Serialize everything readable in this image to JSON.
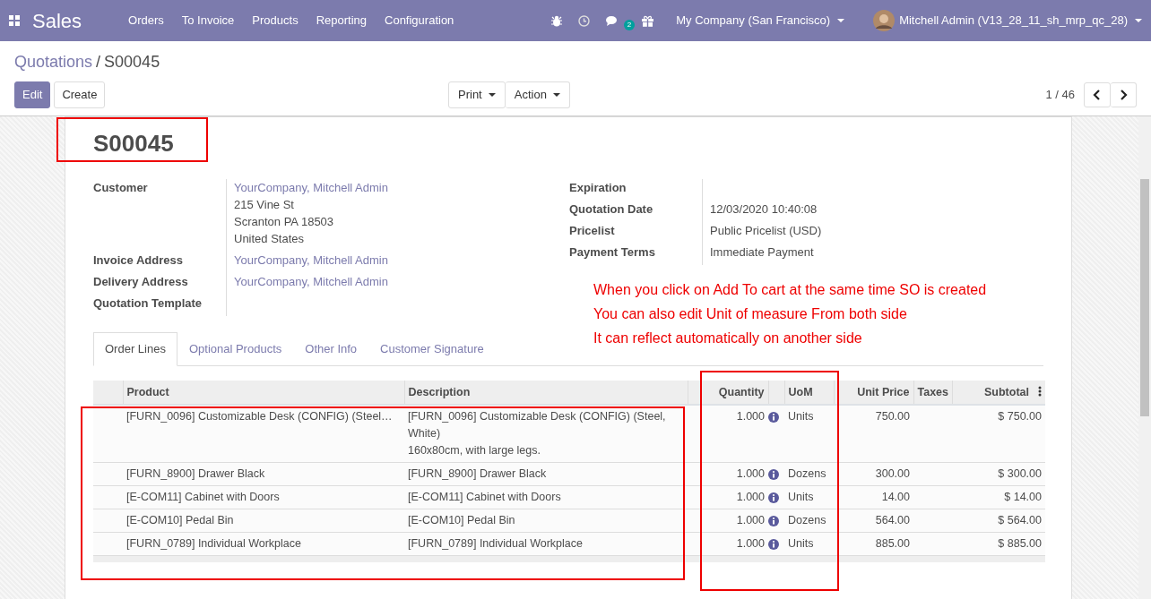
{
  "navbar": {
    "app_name": "Sales",
    "menu": [
      "Orders",
      "To Invoice",
      "Products",
      "Reporting",
      "Configuration"
    ],
    "messages_count": "2",
    "company": "My Company (San Francisco)",
    "user": "Mitchell Admin (V13_28_11_sh_mrp_qc_28)"
  },
  "breadcrumb_separator": "/",
  "breadcrumb": [
    {
      "label": "Quotations",
      "selected": false
    },
    {
      "label": "S00045",
      "selected": true
    }
  ],
  "buttons": {
    "edit": "Edit",
    "create": "Create",
    "print": "Print",
    "action": "Action"
  },
  "pager": "1 / 46",
  "record": {
    "title": "S00045",
    "left_fields": [
      {
        "label": "Customer",
        "lines": [
          {
            "text": "YourCompany, Mitchell Admin",
            "kind": "link"
          },
          {
            "text": "215 Vine St",
            "kind": "text"
          },
          {
            "text": "Scranton PA 18503",
            "kind": "text"
          },
          {
            "text": "United States",
            "kind": "text"
          }
        ]
      },
      {
        "label": "Invoice Address",
        "lines": [
          {
            "text": "YourCompany, Mitchell Admin",
            "kind": "link"
          }
        ]
      },
      {
        "label": "Delivery Address",
        "lines": [
          {
            "text": "YourCompany, Mitchell Admin",
            "kind": "link"
          }
        ]
      },
      {
        "label": "Quotation Template"
      }
    ],
    "right_fields": [
      {
        "label": "Expiration"
      },
      {
        "label": "Quotation Date",
        "value": "12/03/2020 10:40:08"
      },
      {
        "label": "Pricelist",
        "value": "Public Pricelist (USD)"
      },
      {
        "label": "Payment Terms",
        "value": "Immediate Payment"
      }
    ]
  },
  "note": [
    "When you click on Add To cart at the same time SO is created",
    "You can also edit Unit of measure From both side",
    "It can reflect automatically on another side"
  ],
  "tabs": [
    {
      "label": "Order Lines",
      "selected": true
    },
    {
      "label": "Optional Products",
      "selected": false
    },
    {
      "label": "Other Info",
      "selected": false
    },
    {
      "label": "Customer Signature",
      "selected": false
    }
  ],
  "table": {
    "columns": [
      "Product",
      "Description",
      "Quantity",
      "UoM",
      "Unit Price",
      "Taxes",
      "Subtotal"
    ],
    "rows": [
      {
        "product": "[FURN_0096] Customizable Desk (CONFIG) (Steel…",
        "description": [
          "[FURN_0096] Customizable Desk (CONFIG) (Steel, White)",
          "160x80cm, with large legs."
        ],
        "quantity": "1.000",
        "uom": "Units",
        "unit_price": "750.00",
        "subtotal": "$ 750.00"
      },
      {
        "product": "[FURN_8900] Drawer Black",
        "description": [
          "[FURN_8900] Drawer Black"
        ],
        "quantity": "1.000",
        "uom": "Dozens",
        "unit_price": "300.00",
        "subtotal": "$ 300.00"
      },
      {
        "product": "[E-COM11] Cabinet with Doors",
        "description": [
          "[E-COM11] Cabinet with Doors"
        ],
        "quantity": "1.000",
        "uom": "Units",
        "unit_price": "14.00",
        "subtotal": "$ 14.00"
      },
      {
        "product": "[E-COM10] Pedal Bin",
        "description": [
          "[E-COM10] Pedal Bin"
        ],
        "quantity": "1.000",
        "uom": "Dozens",
        "unit_price": "564.00",
        "subtotal": "$ 564.00"
      },
      {
        "product": "[FURN_0789] Individual Workplace",
        "description": [
          "[FURN_0789] Individual Workplace"
        ],
        "quantity": "1.000",
        "uom": "Units",
        "unit_price": "885.00",
        "subtotal": "$ 885.00"
      }
    ]
  }
}
